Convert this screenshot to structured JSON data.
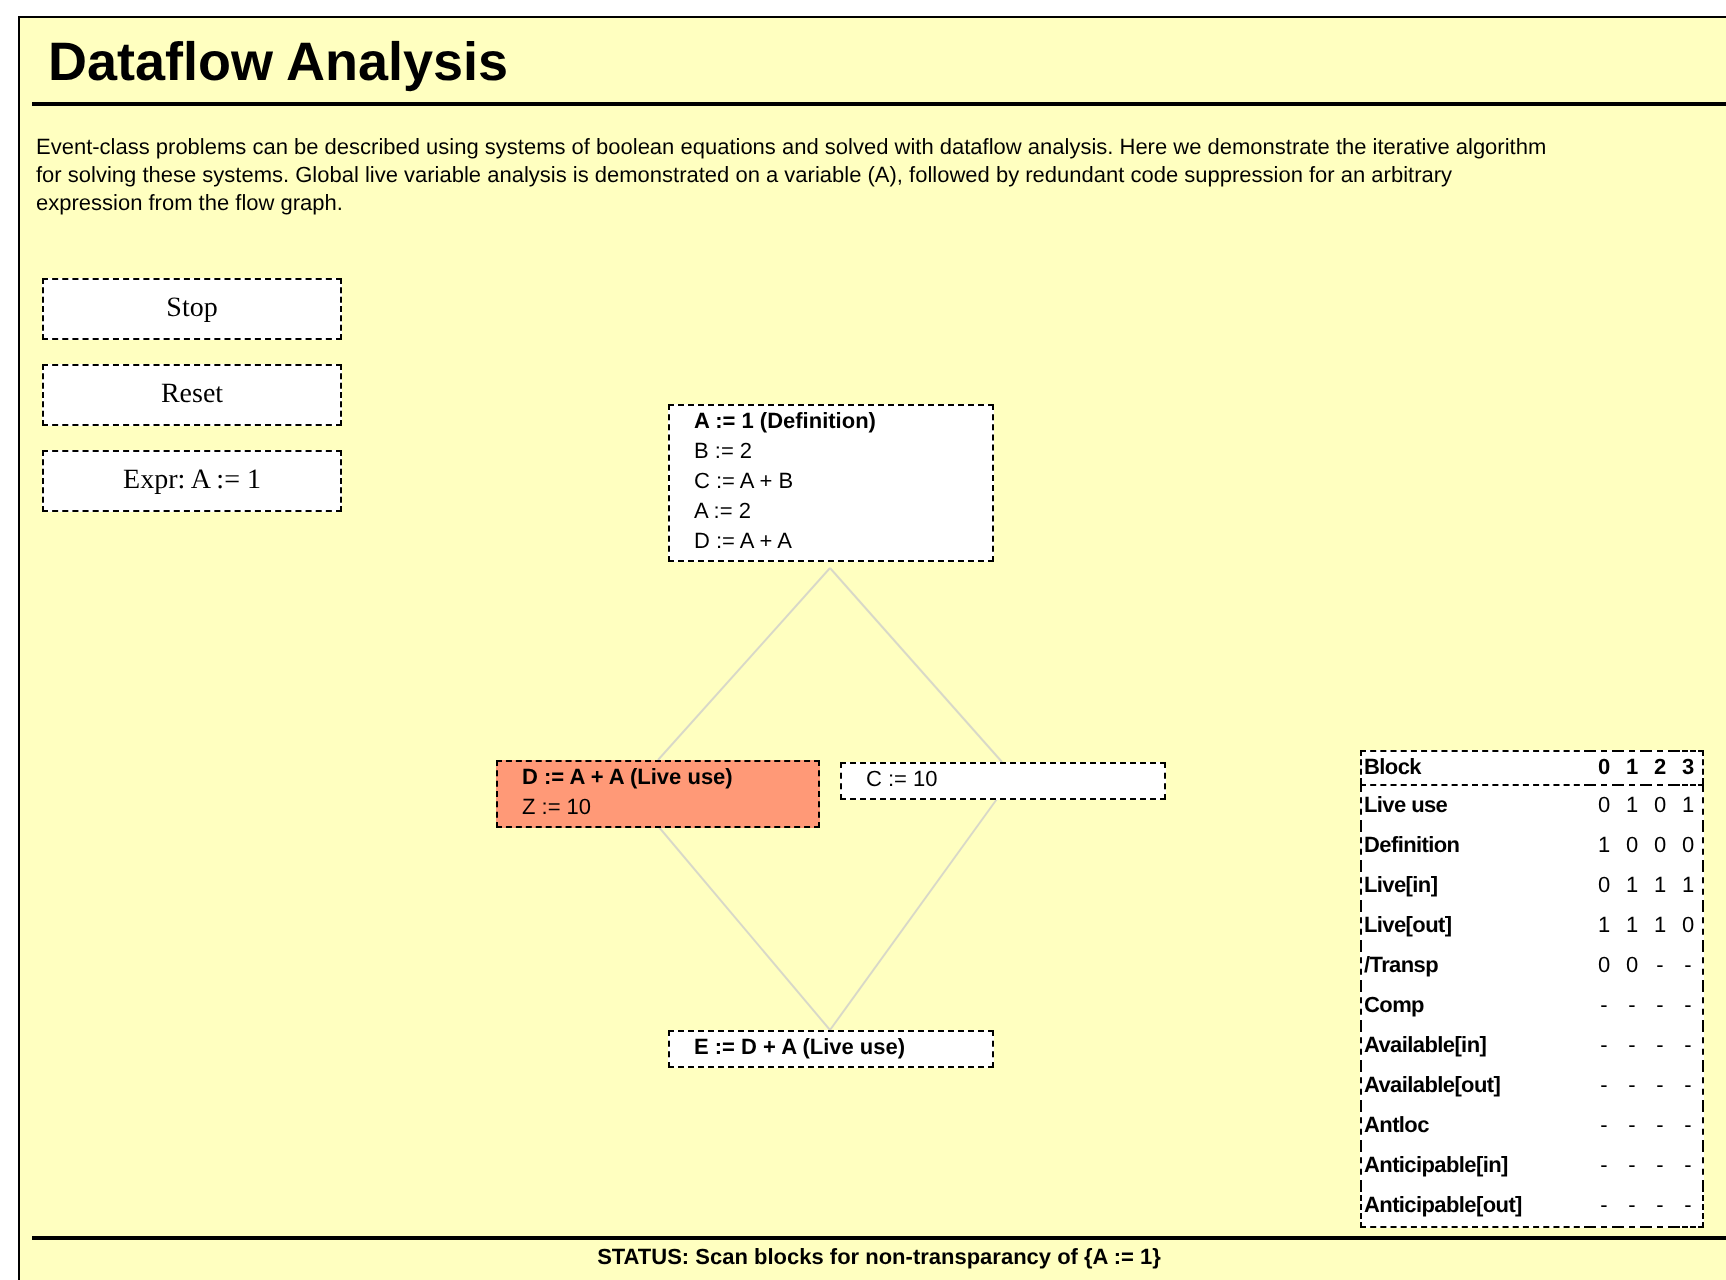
{
  "title": "Dataflow Analysis",
  "description": "Event-class problems can be described using systems of boolean equations and solved with dataflow analysis. Here we demonstrate the iterative algorithm for solving these systems. Global live variable analysis is demonstrated on a variable (A), followed by redundant code suppression for an arbitrary expression from the flow graph.",
  "buttons": [
    "Stop",
    "Reset",
    "Expr: A := 1"
  ],
  "blocks": [
    {
      "highlighted": false,
      "lines": [
        {
          "text": "A := 1 (Definition)",
          "bold": true
        },
        {
          "text": "B := 2",
          "bold": false
        },
        {
          "text": "C := A + B",
          "bold": false
        },
        {
          "text": "A := 2",
          "bold": false
        },
        {
          "text": "D := A + A",
          "bold": false
        }
      ]
    },
    {
      "highlighted": true,
      "lines": [
        {
          "text": "D := A + A (Live use)",
          "bold": true
        },
        {
          "text": "Z := 10",
          "bold": false
        }
      ]
    },
    {
      "highlighted": false,
      "lines": [
        {
          "text": "C := 10",
          "bold": false
        }
      ]
    },
    {
      "highlighted": false,
      "lines": [
        {
          "text": "E := D + A (Live use)",
          "bold": true
        }
      ]
    }
  ],
  "table": {
    "columns": [
      "Block",
      "0",
      "1",
      "2",
      "3"
    ],
    "rows": [
      [
        "Live use",
        "0",
        "1",
        "0",
        "1"
      ],
      [
        "Definition",
        "1",
        "0",
        "0",
        "0"
      ],
      [
        "Live[in]",
        "0",
        "1",
        "1",
        "1"
      ],
      [
        "Live[out]",
        "1",
        "1",
        "1",
        "0"
      ],
      [
        "/Transp",
        "0",
        "0",
        "-",
        "-"
      ],
      [
        "Comp",
        "-",
        "-",
        "-",
        "-"
      ],
      [
        "Available[in]",
        "-",
        "-",
        "-",
        "-"
      ],
      [
        "Available[out]",
        "-",
        "-",
        "-",
        "-"
      ],
      [
        "Antloc",
        "-",
        "-",
        "-",
        "-"
      ],
      [
        "Anticipable[in]",
        "-",
        "-",
        "-",
        "-"
      ],
      [
        "Anticipable[out]",
        "-",
        "-",
        "-",
        "-"
      ]
    ]
  },
  "status": "STATUS: Scan blocks for non-transparancy of {A := 1}"
}
